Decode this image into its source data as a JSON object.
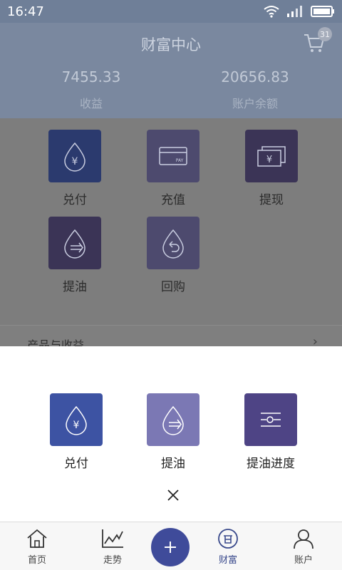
{
  "status_bar": {
    "time": "16:47"
  },
  "header": {
    "title": "财富中心",
    "cart_badge": "31",
    "stats": [
      {
        "value": "7455.33",
        "label": "收益"
      },
      {
        "value": "20656.83",
        "label": "账户余额"
      }
    ]
  },
  "grid": {
    "items": [
      {
        "label": "兑付",
        "icon": "drop-yen-icon",
        "color": "#2b3a6e"
      },
      {
        "label": "充值",
        "icon": "card-icon",
        "color": "#4d4a6e"
      },
      {
        "label": "提现",
        "icon": "cash-icon",
        "color": "#3b3456"
      },
      {
        "label": "提油",
        "icon": "drop-arrow-icon",
        "color": "#3b3456"
      },
      {
        "label": "回购",
        "icon": "drop-return-icon",
        "color": "#4d4a6e"
      }
    ],
    "section_title": "产品与收益"
  },
  "sheet": {
    "items": [
      {
        "label": "兑付",
        "icon": "drop-yen-icon",
        "color": "#3d53a3"
      },
      {
        "label": "提油",
        "icon": "drop-arrow-icon",
        "color": "#7b78b4"
      },
      {
        "label": "提油进度",
        "icon": "sliders-icon",
        "color": "#4e4485"
      }
    ]
  },
  "bottom_nav": {
    "items": [
      {
        "label": "首页",
        "icon": "home-icon"
      },
      {
        "label": "走势",
        "icon": "chart-icon"
      },
      {
        "label": "财富",
        "icon": "wealth-icon",
        "active": true
      },
      {
        "label": "账户",
        "icon": "user-icon"
      }
    ]
  }
}
